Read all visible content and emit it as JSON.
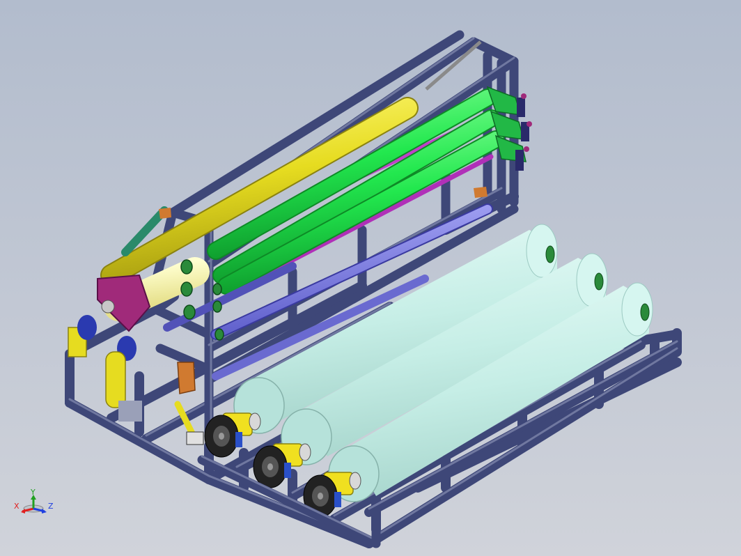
{
  "viewport": {
    "background_top": "#b2bccd",
    "background_bottom": "#d0d3da"
  },
  "model": {
    "frame_color": "#3e4778",
    "frame_highlight": "#6b7396",
    "big_roller_color": "#c8f0e8",
    "green_roller_color": "#22e84e",
    "yellow_roller_color": "#e6dc20",
    "magenta_roller_color": "#c040c8",
    "blue_roller_color": "#7878e0",
    "bearing_color": "#f0e020",
    "motor_color": "#222222"
  },
  "triad": {
    "x_label": "X",
    "y_label": "Y",
    "z_label": "Z",
    "x_color": "#e02020",
    "y_color": "#20a020",
    "z_color": "#2040e0"
  }
}
